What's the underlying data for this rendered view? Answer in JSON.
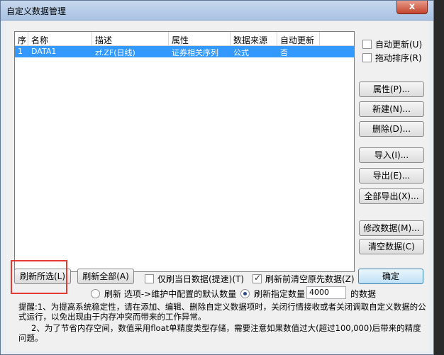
{
  "window": {
    "title": "自定义数据管理",
    "close_label": "x"
  },
  "table": {
    "columns": [
      "序",
      "名称",
      "描述",
      "属性",
      "数据来源",
      "自动更新"
    ],
    "rows": [
      [
        "1",
        "DATA1",
        "zf.ZF(日线)",
        "证券相关序列",
        "公式",
        "否"
      ]
    ]
  },
  "side_options": {
    "auto_update": "自动更新(U)",
    "drag_sort": "拖动排序(R)"
  },
  "side_buttons": {
    "properties": "属性(P)...",
    "new": "新建(N)...",
    "delete": "删除(D)...",
    "import": "导入(I)...",
    "export": "导出(E)...",
    "export_all": "全部导出(X)...",
    "modify": "修改数据(M)...",
    "clear": "清空数据(C)"
  },
  "bottom": {
    "refresh_selected": "刷新所选(L)",
    "refresh_all": "刷新全部(A)",
    "today_only": "仅刷当日数据(提速)(T)",
    "clear_before": "刷新前清空原先数据(Z)",
    "ok": "确定",
    "radio_default": "刷新 选项->维护中配置的默认数量",
    "radio_custom": "刷新指定数量",
    "count_value": "4000",
    "count_suffix": "的数据"
  },
  "tips": {
    "line1": "提醒:1、为提高系统稳定性，请在添加、编辑、删除自定义数据项时，关闭行情接收或者关闭调取自定义数据的公式运行，以免出现由于内存冲突而带来的工作异常。",
    "line2": "2、为了节省内存空间，数值采用float单精度类型存储，需要注意如果数值过大(超过100,000)后带来的精度问题。"
  }
}
